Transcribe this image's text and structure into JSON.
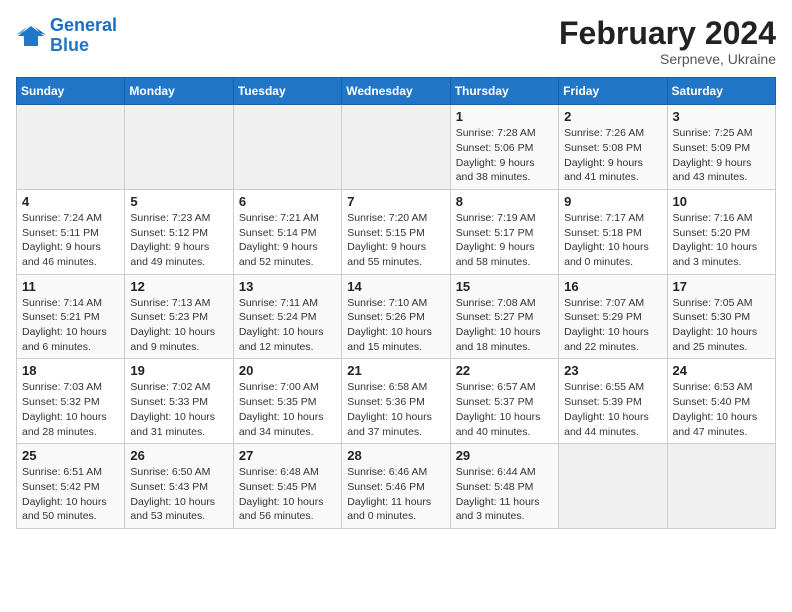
{
  "header": {
    "logo_line1": "General",
    "logo_line2": "Blue",
    "month_title": "February 2024",
    "subtitle": "Serpneve, Ukraine"
  },
  "weekdays": [
    "Sunday",
    "Monday",
    "Tuesday",
    "Wednesday",
    "Thursday",
    "Friday",
    "Saturday"
  ],
  "weeks": [
    [
      {
        "day": "",
        "info": ""
      },
      {
        "day": "",
        "info": ""
      },
      {
        "day": "",
        "info": ""
      },
      {
        "day": "",
        "info": ""
      },
      {
        "day": "1",
        "info": "Sunrise: 7:28 AM\nSunset: 5:06 PM\nDaylight: 9 hours\nand 38 minutes."
      },
      {
        "day": "2",
        "info": "Sunrise: 7:26 AM\nSunset: 5:08 PM\nDaylight: 9 hours\nand 41 minutes."
      },
      {
        "day": "3",
        "info": "Sunrise: 7:25 AM\nSunset: 5:09 PM\nDaylight: 9 hours\nand 43 minutes."
      }
    ],
    [
      {
        "day": "4",
        "info": "Sunrise: 7:24 AM\nSunset: 5:11 PM\nDaylight: 9 hours\nand 46 minutes."
      },
      {
        "day": "5",
        "info": "Sunrise: 7:23 AM\nSunset: 5:12 PM\nDaylight: 9 hours\nand 49 minutes."
      },
      {
        "day": "6",
        "info": "Sunrise: 7:21 AM\nSunset: 5:14 PM\nDaylight: 9 hours\nand 52 minutes."
      },
      {
        "day": "7",
        "info": "Sunrise: 7:20 AM\nSunset: 5:15 PM\nDaylight: 9 hours\nand 55 minutes."
      },
      {
        "day": "8",
        "info": "Sunrise: 7:19 AM\nSunset: 5:17 PM\nDaylight: 9 hours\nand 58 minutes."
      },
      {
        "day": "9",
        "info": "Sunrise: 7:17 AM\nSunset: 5:18 PM\nDaylight: 10 hours\nand 0 minutes."
      },
      {
        "day": "10",
        "info": "Sunrise: 7:16 AM\nSunset: 5:20 PM\nDaylight: 10 hours\nand 3 minutes."
      }
    ],
    [
      {
        "day": "11",
        "info": "Sunrise: 7:14 AM\nSunset: 5:21 PM\nDaylight: 10 hours\nand 6 minutes."
      },
      {
        "day": "12",
        "info": "Sunrise: 7:13 AM\nSunset: 5:23 PM\nDaylight: 10 hours\nand 9 minutes."
      },
      {
        "day": "13",
        "info": "Sunrise: 7:11 AM\nSunset: 5:24 PM\nDaylight: 10 hours\nand 12 minutes."
      },
      {
        "day": "14",
        "info": "Sunrise: 7:10 AM\nSunset: 5:26 PM\nDaylight: 10 hours\nand 15 minutes."
      },
      {
        "day": "15",
        "info": "Sunrise: 7:08 AM\nSunset: 5:27 PM\nDaylight: 10 hours\nand 18 minutes."
      },
      {
        "day": "16",
        "info": "Sunrise: 7:07 AM\nSunset: 5:29 PM\nDaylight: 10 hours\nand 22 minutes."
      },
      {
        "day": "17",
        "info": "Sunrise: 7:05 AM\nSunset: 5:30 PM\nDaylight: 10 hours\nand 25 minutes."
      }
    ],
    [
      {
        "day": "18",
        "info": "Sunrise: 7:03 AM\nSunset: 5:32 PM\nDaylight: 10 hours\nand 28 minutes."
      },
      {
        "day": "19",
        "info": "Sunrise: 7:02 AM\nSunset: 5:33 PM\nDaylight: 10 hours\nand 31 minutes."
      },
      {
        "day": "20",
        "info": "Sunrise: 7:00 AM\nSunset: 5:35 PM\nDaylight: 10 hours\nand 34 minutes."
      },
      {
        "day": "21",
        "info": "Sunrise: 6:58 AM\nSunset: 5:36 PM\nDaylight: 10 hours\nand 37 minutes."
      },
      {
        "day": "22",
        "info": "Sunrise: 6:57 AM\nSunset: 5:37 PM\nDaylight: 10 hours\nand 40 minutes."
      },
      {
        "day": "23",
        "info": "Sunrise: 6:55 AM\nSunset: 5:39 PM\nDaylight: 10 hours\nand 44 minutes."
      },
      {
        "day": "24",
        "info": "Sunrise: 6:53 AM\nSunset: 5:40 PM\nDaylight: 10 hours\nand 47 minutes."
      }
    ],
    [
      {
        "day": "25",
        "info": "Sunrise: 6:51 AM\nSunset: 5:42 PM\nDaylight: 10 hours\nand 50 minutes."
      },
      {
        "day": "26",
        "info": "Sunrise: 6:50 AM\nSunset: 5:43 PM\nDaylight: 10 hours\nand 53 minutes."
      },
      {
        "day": "27",
        "info": "Sunrise: 6:48 AM\nSunset: 5:45 PM\nDaylight: 10 hours\nand 56 minutes."
      },
      {
        "day": "28",
        "info": "Sunrise: 6:46 AM\nSunset: 5:46 PM\nDaylight: 11 hours\nand 0 minutes."
      },
      {
        "day": "29",
        "info": "Sunrise: 6:44 AM\nSunset: 5:48 PM\nDaylight: 11 hours\nand 3 minutes."
      },
      {
        "day": "",
        "info": ""
      },
      {
        "day": "",
        "info": ""
      }
    ]
  ]
}
